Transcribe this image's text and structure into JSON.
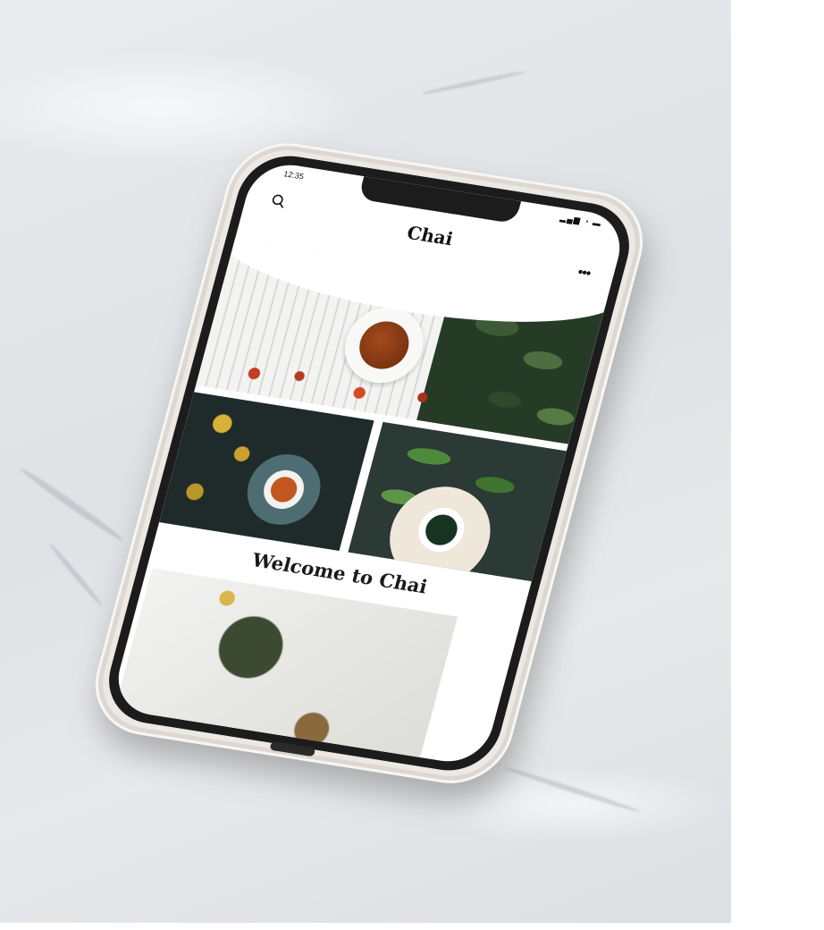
{
  "app": {
    "title": "Chai",
    "status_time": "12:35",
    "status_icons": "▂▄▆ ◔ ▬",
    "more_label": "•••"
  },
  "content": {
    "welcome_heading": "Welcome to Chai"
  },
  "icons": {
    "search": "search-icon",
    "more": "more-icon"
  },
  "colors": {
    "text": "#111111",
    "case": "#ece9e4",
    "bezel": "#1c1c1c"
  }
}
